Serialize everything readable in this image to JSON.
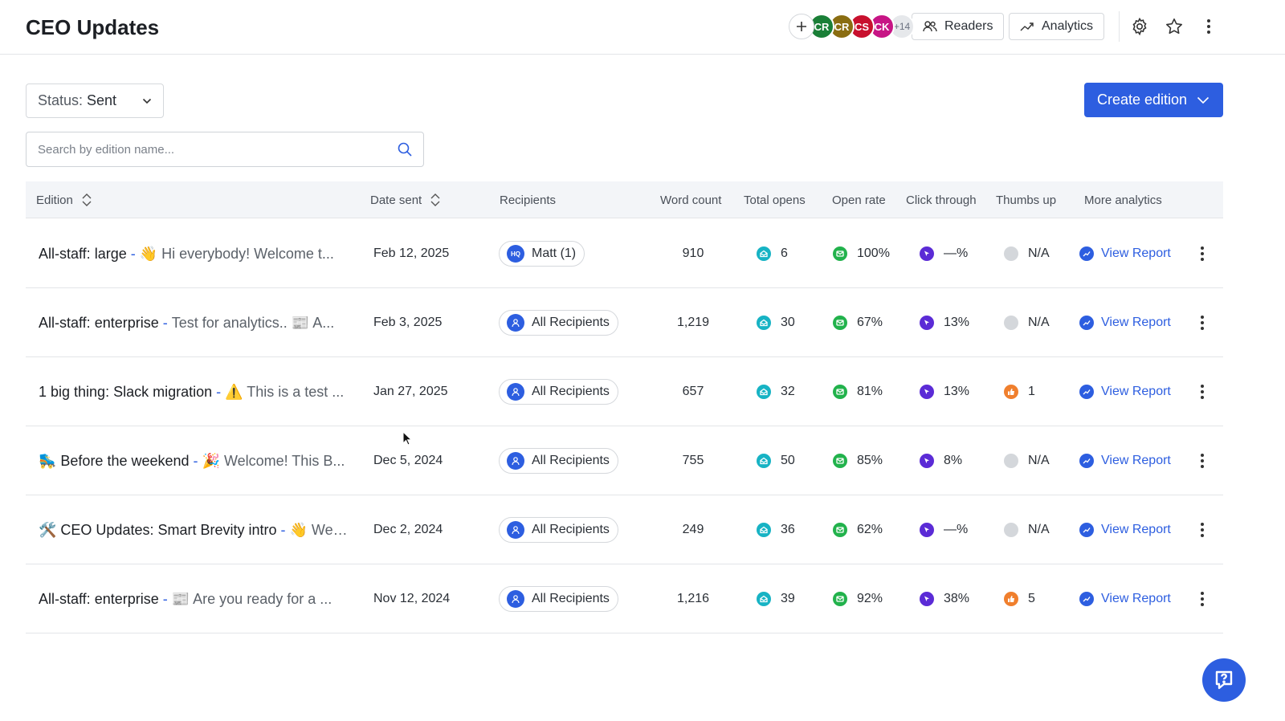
{
  "header": {
    "title": "CEO Updates",
    "avatars": [
      {
        "initials": "CR",
        "color": "#1a7f37"
      },
      {
        "initials": "CR",
        "color": "#8a6d12"
      },
      {
        "initials": "CS",
        "color": "#c8102e"
      },
      {
        "initials": "CK",
        "color": "#c71585"
      }
    ],
    "avatars_more": "+14",
    "readers_label": "Readers",
    "analytics_label": "Analytics"
  },
  "toolbar": {
    "status_label": "Status:",
    "status_value": "Sent",
    "create_label": "Create edition",
    "search_placeholder": "Search by edition name..."
  },
  "table": {
    "columns": {
      "edition": "Edition",
      "date_sent": "Date sent",
      "recipients": "Recipients",
      "word_count": "Word count",
      "total_opens": "Total opens",
      "open_rate": "Open rate",
      "click_through": "Click through",
      "thumbs_up": "Thumbs up",
      "more_analytics": "More analytics"
    },
    "rows": [
      {
        "name": "All-staff: large",
        "preview": "👋 Hi everybody! Welcome t...",
        "date": "Feb 12, 2025",
        "recipients": "Matt (1)",
        "recipient_icon": "HQ",
        "word_count": "910",
        "opens": "6",
        "open_rate": "100%",
        "click_through": "—%",
        "thumbs": "N/A",
        "report": "View Report"
      },
      {
        "name": "All-staff: enterprise",
        "preview": "Test for analytics.. 📰 A...",
        "date": "Feb 3, 2025",
        "recipients": "All Recipients",
        "recipient_icon": "",
        "word_count": "1,219",
        "opens": "30",
        "open_rate": "67%",
        "click_through": "13%",
        "thumbs": "N/A",
        "report": "View Report"
      },
      {
        "name": "1 big thing: Slack migration",
        "preview": "⚠️ This is a test ...",
        "date": "Jan 27, 2025",
        "recipients": "All Recipients",
        "recipient_icon": "",
        "word_count": "657",
        "opens": "32",
        "open_rate": "81%",
        "click_through": "13%",
        "thumbs": "1",
        "report": "View Report"
      },
      {
        "name": "🛼 Before the weekend",
        "preview": "🎉 Welcome! This B...",
        "date": "Dec 5, 2024",
        "recipients": "All Recipients",
        "recipient_icon": "",
        "word_count": "755",
        "opens": "50",
        "open_rate": "85%",
        "click_through": "8%",
        "thumbs": "N/A",
        "report": "View Report"
      },
      {
        "name": "🛠️ CEO Updates: Smart Brevity intro",
        "preview": "👋 We’...",
        "date": "Dec 2, 2024",
        "recipients": "All Recipients",
        "recipient_icon": "",
        "word_count": "249",
        "opens": "36",
        "open_rate": "62%",
        "click_through": "—%",
        "thumbs": "N/A",
        "report": "View Report"
      },
      {
        "name": "All-staff: enterprise",
        "preview": "📰 Are you ready for a ...",
        "date": "Nov 12, 2024",
        "recipients": "All Recipients",
        "recipient_icon": "",
        "word_count": "1,216",
        "opens": "39",
        "open_rate": "92%",
        "click_through": "38%",
        "thumbs": "5",
        "report": "View Report"
      }
    ]
  },
  "colors": {
    "accent": "#2d5ee0",
    "opens": "#17b3c4",
    "open_rate": "#22b24c",
    "click": "#5b2bd6",
    "thumbs_active": "#f07f2d",
    "thumbs_na": "#d4d7db"
  },
  "icons": [
    "plus-icon",
    "readers-icon",
    "analytics-icon",
    "gear-icon",
    "star-icon",
    "more-vertical-icon",
    "chevron-down-icon",
    "search-icon",
    "sort-icon",
    "users-icon",
    "opens-icon",
    "open-rate-icon",
    "click-icon",
    "thumbs-up-icon",
    "report-icon",
    "help-icon"
  ]
}
